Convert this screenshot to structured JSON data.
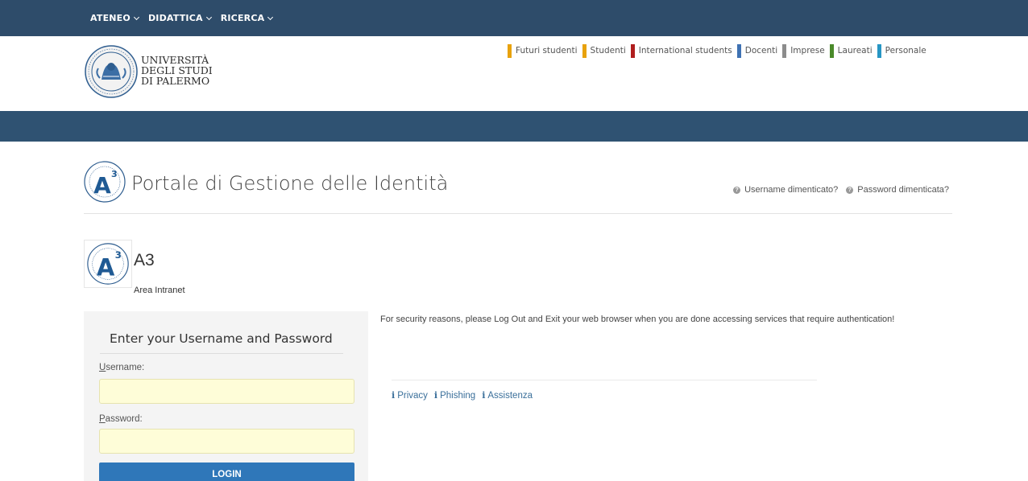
{
  "topnav": {
    "items": [
      {
        "label": "ATENEO"
      },
      {
        "label": "DIDATTICA"
      },
      {
        "label": "RICERCA"
      }
    ]
  },
  "header": {
    "university": {
      "line1": "UNIVERSITÀ",
      "line2": "DEGLI STUDI",
      "line3": "DI PALERMO"
    },
    "audience_links": [
      {
        "label": "Futuri studenti",
        "color": "#e8a20d"
      },
      {
        "label": "Studenti",
        "color": "#e8a20d"
      },
      {
        "label": "International students",
        "color": "#b01e1e"
      },
      {
        "label": "Docenti",
        "color": "#3f72b3"
      },
      {
        "label": "Imprese",
        "color": "#8c8c8c"
      },
      {
        "label": "Laureati",
        "color": "#4a8a2a"
      },
      {
        "label": "Personale",
        "color": "#2796c4"
      }
    ]
  },
  "portal": {
    "title": "Portale di Gestione delle Identità",
    "forgot_username": "Username dimenticato?",
    "forgot_password": "Password dimenticata?"
  },
  "app": {
    "name": "A3",
    "subtitle": "Area Intranet"
  },
  "login": {
    "title": "Enter your Username and Password",
    "username_label_first": "U",
    "username_label_rest": "sername:",
    "username_value": "",
    "password_label_first": "P",
    "password_label_rest": "assword:",
    "password_value": "",
    "button": "LOGIN"
  },
  "notice": {
    "text": "For security reasons, please Log Out and Exit your web browser when you are done accessing services that require authentication!"
  },
  "info_links": {
    "privacy": "Privacy",
    "phishing": "Phishing",
    "assistenza": "Assistenza"
  },
  "colors": {
    "topnav_bg": "#2e4c6a",
    "bluebar_bg": "#2f5272",
    "login_button": "#2f77b9",
    "input_bg": "#fefdd8",
    "link": "#3a6f9a"
  }
}
